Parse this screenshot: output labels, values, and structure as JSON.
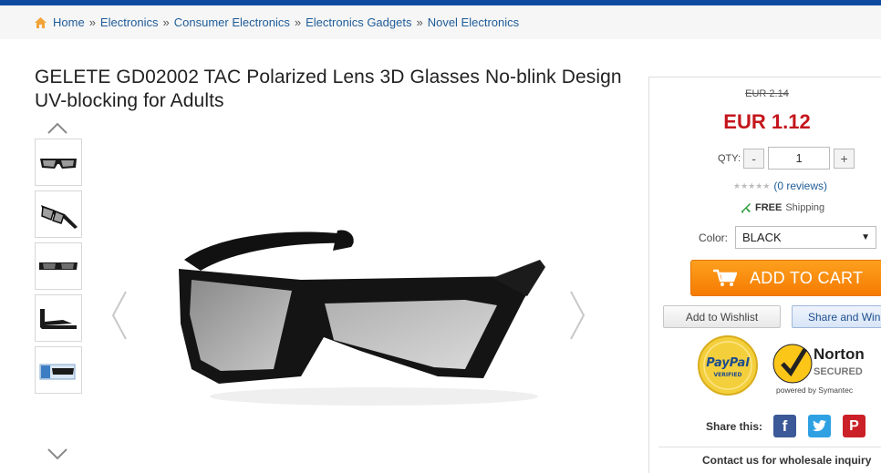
{
  "breadcrumb": {
    "items": [
      "Home",
      "Electronics",
      "Consumer Electronics",
      "Electronics Gadgets",
      "Novel Electronics"
    ],
    "separator": "»"
  },
  "product": {
    "title": "GELETE GD02002 TAC Polarized Lens 3D Glasses No-blink Design UV-blocking for Adults"
  },
  "gallery": {
    "thumbnail_count": 5
  },
  "buybox": {
    "old_price": "EUR 2.14",
    "price": "EUR 1.12",
    "qty_label": "QTY:",
    "qty_minus": "-",
    "qty_value": "1",
    "qty_plus": "+",
    "reviews": "(0 reviews)",
    "shipping_free": "FREE",
    "shipping_label": "Shipping",
    "color_label": "Color:",
    "color_value": "BLACK",
    "add_to_cart": "ADD TO CART",
    "wishlist": "Add to Wishlist",
    "share_and_win": "Share and Win",
    "share_label": "Share this:",
    "wholesale": "Contact us for wholesale inquiry"
  },
  "seals": {
    "paypal_top": "PayPal",
    "paypal_bottom": "VERIFIED",
    "norton_name": "Norton",
    "norton_secured": "SECURED",
    "norton_powered": "powered by Symantec"
  },
  "colors": {
    "top_bar": "#0f4aa1",
    "link": "#1f5c99",
    "price": "#c4161c",
    "cart_button": "#f57b02"
  },
  "icons": [
    "home-icon",
    "chevron-up-icon",
    "chevron-down-icon",
    "chevron-left-icon",
    "chevron-right-icon",
    "plane-icon",
    "cart-icon",
    "facebook-icon",
    "twitter-icon",
    "pinterest-icon"
  ]
}
